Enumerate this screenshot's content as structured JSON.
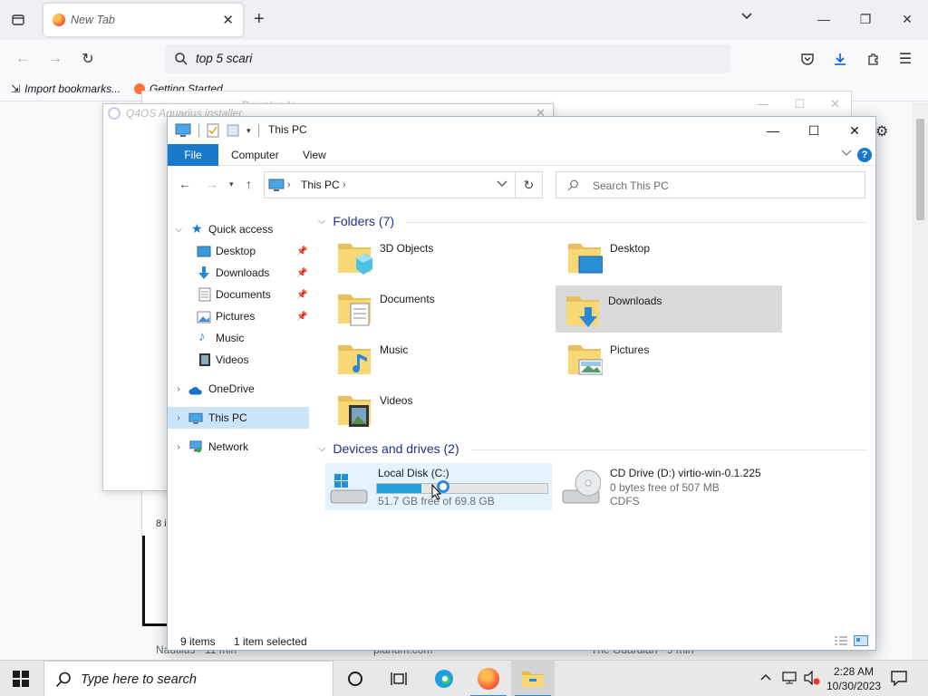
{
  "browser": {
    "tab_title": "New Tab",
    "url_text": "top  5 scari",
    "bookmarks": [
      {
        "label": "Import bookmarks..."
      },
      {
        "label": "Getting Started"
      }
    ]
  },
  "background": {
    "win1_title": "Q4OS Aquarius installer",
    "win2_title": "Downloads",
    "items_text": "8 i",
    "bottom_texts": [
      "Nautilus · 11 min",
      "planum.com",
      "The Guardian · 9 min"
    ]
  },
  "explorer": {
    "title": "This PC",
    "ribbon_tabs": [
      "File",
      "Computer",
      "View"
    ],
    "help_label": "?",
    "address": {
      "location": "This PC"
    },
    "search_placeholder": "Search This PC",
    "nav": {
      "quick_access": "Quick access",
      "quick_items": [
        {
          "label": "Desktop",
          "pinned": true,
          "icon": "desktop-icon"
        },
        {
          "label": "Downloads",
          "pinned": true,
          "icon": "download-icon"
        },
        {
          "label": "Documents",
          "pinned": true,
          "icon": "document-icon"
        },
        {
          "label": "Pictures",
          "pinned": true,
          "icon": "picture-icon"
        },
        {
          "label": "Music",
          "pinned": false,
          "icon": "music-icon"
        },
        {
          "label": "Videos",
          "pinned": false,
          "icon": "video-icon"
        }
      ],
      "onedrive": "OneDrive",
      "this_pc": "This PC",
      "network": "Network"
    },
    "folders_header": "Folders (7)",
    "folders": [
      {
        "label": "3D Objects",
        "icon": "3d-objects-folder-icon"
      },
      {
        "label": "Desktop",
        "icon": "desktop-folder-icon"
      },
      {
        "label": "Documents",
        "icon": "documents-folder-icon"
      },
      {
        "label": "Downloads",
        "icon": "downloads-folder-icon",
        "selected": true
      },
      {
        "label": "Music",
        "icon": "music-folder-icon"
      },
      {
        "label": "Pictures",
        "icon": "pictures-folder-icon"
      },
      {
        "label": "Videos",
        "icon": "videos-folder-icon"
      }
    ],
    "drives_header": "Devices and drives (2)",
    "drives": [
      {
        "name": "Local Disk (C:)",
        "free_text": "51.7 GB free of 69.8 GB",
        "used_fraction": 0.26,
        "icon": "local-disk-icon"
      },
      {
        "name": "CD Drive (D:) virtio-win-0.1.225",
        "line2": "0 bytes free of 507 MB",
        "line3": "CDFS",
        "icon": "cd-drive-icon"
      }
    ],
    "status": {
      "count": "9 items",
      "selected": "1 item selected"
    }
  },
  "taskbar": {
    "search_placeholder": "Type here to search",
    "time": "2:28 AM",
    "date": "10/30/2023"
  },
  "colors": {
    "accent": "#1979ca",
    "selection": "#cce4f7",
    "folder": "#f8d775",
    "header": "#1e3287"
  }
}
